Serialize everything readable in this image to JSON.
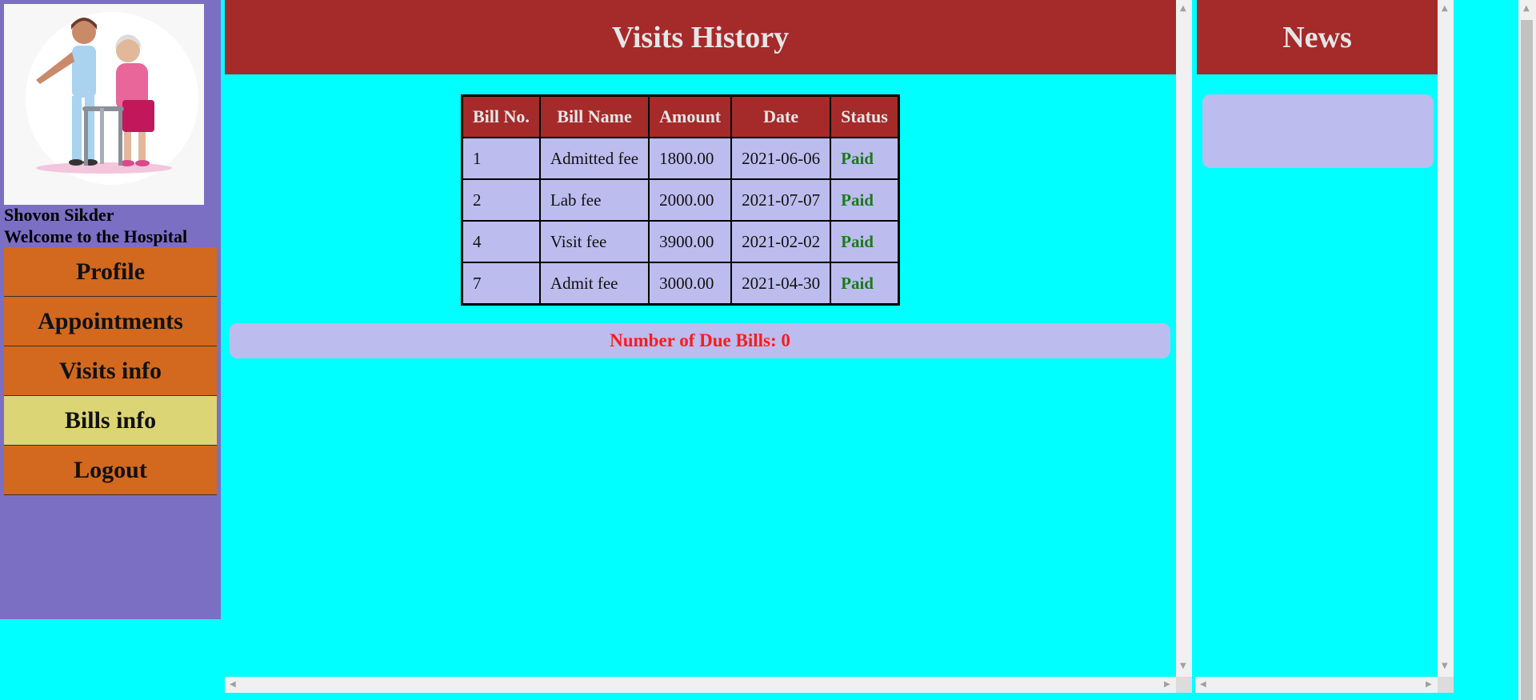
{
  "sidebar": {
    "user_name": "Shovon Sikder",
    "welcome": "Welcome to the Hospital",
    "nav": [
      {
        "label": "Profile",
        "active": false
      },
      {
        "label": "Appointments",
        "active": false
      },
      {
        "label": "Visits info",
        "active": false
      },
      {
        "label": "Bills info",
        "active": true
      },
      {
        "label": "Logout",
        "active": false
      }
    ]
  },
  "main": {
    "title": "Visits History",
    "table": {
      "headers": [
        "Bill No.",
        "Bill Name",
        "Amount",
        "Date",
        "Status"
      ],
      "rows": [
        [
          "1",
          "Admitted fee",
          "1800.00",
          "2021-06-06",
          "Paid"
        ],
        [
          "2",
          "Lab fee",
          "2000.00",
          "2021-07-07",
          "Paid"
        ],
        [
          "4",
          "Visit fee",
          "3900.00",
          "2021-02-02",
          "Paid"
        ],
        [
          "7",
          "Admit fee",
          "3000.00",
          "2021-04-30",
          "Paid"
        ]
      ]
    },
    "due_bills": "Number of Due Bills: 0"
  },
  "news": {
    "title": "News"
  },
  "colors": {
    "background": "#00ffff",
    "sidebar": "#7b6fc4",
    "header": "#a52a2a",
    "nav_item": "#d2691e",
    "nav_active": "#dcd575",
    "cell": "#bcbcee",
    "paid": "#1b7a1b",
    "due_text": "#ff1a1a"
  }
}
